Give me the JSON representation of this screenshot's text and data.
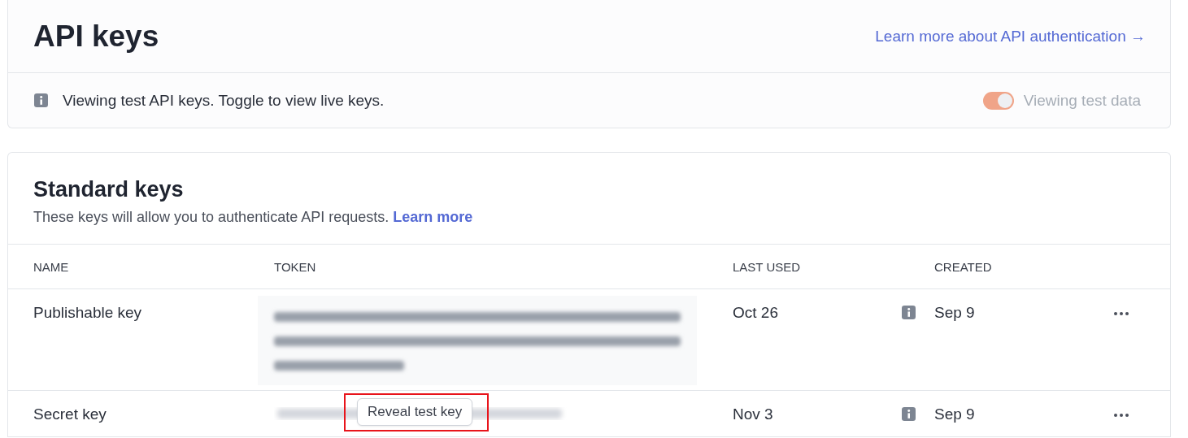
{
  "header": {
    "title": "API keys",
    "link": "Learn more about API authentication →"
  },
  "notice": {
    "text": "Viewing test API keys. Toggle to view live keys.",
    "toggle": {
      "label": "Viewing test data",
      "on": true
    }
  },
  "standard_keys": {
    "title": "Standard keys",
    "description": "These keys will allow you to authenticate API requests.",
    "link": "Learn more",
    "columns": [
      "NAME",
      "TOKEN",
      "LAST USED",
      "CREATED"
    ],
    "rows": [
      {
        "name": "Publishable key",
        "last_used": "Oct 26",
        "created": "Sep 9",
        "highlighted": false
      },
      {
        "name": "Secret key",
        "reveal_button": "Reveal test key",
        "last_used": "Nov 3",
        "created": "Sep 9",
        "highlighted": true
      }
    ]
  }
}
